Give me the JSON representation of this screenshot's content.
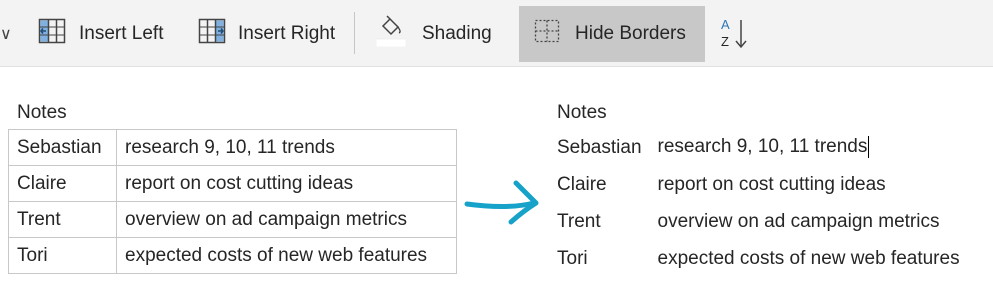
{
  "ribbon": {
    "insert_left": "Insert Left",
    "insert_right": "Insert Right",
    "shading": "Shading",
    "hide_borders": "Hide Borders",
    "sort_glyph_a": "A",
    "sort_glyph_z": "Z"
  },
  "colors": {
    "accent_blue": "#2e75b6",
    "arrow_teal": "#17a2c9",
    "active_button_bg": "#c8c8c8"
  },
  "left_table": {
    "title": "Notes",
    "rows": [
      {
        "name": "Sebastian",
        "task": "research 9, 10, 11 trends"
      },
      {
        "name": "Claire",
        "task": "report on cost cutting ideas"
      },
      {
        "name": "Trent",
        "task": "overview on ad campaign metrics"
      },
      {
        "name": "Tori",
        "task": "expected costs of new web features"
      }
    ]
  },
  "right_table": {
    "title": "Notes",
    "rows": [
      {
        "name": "Sebastian",
        "task": "research 9, 10, 11 trends"
      },
      {
        "name": "Claire",
        "task": "report on cost cutting ideas"
      },
      {
        "name": "Trent",
        "task": "overview on ad campaign metrics"
      },
      {
        "name": "Tori",
        "task": "expected costs of new web features"
      }
    ]
  },
  "icons": [
    "chevron-down-icon",
    "insert-left-icon",
    "insert-right-icon",
    "paint-bucket-icon",
    "hide-borders-icon",
    "sort-icon",
    "arrow-right-icon"
  ]
}
